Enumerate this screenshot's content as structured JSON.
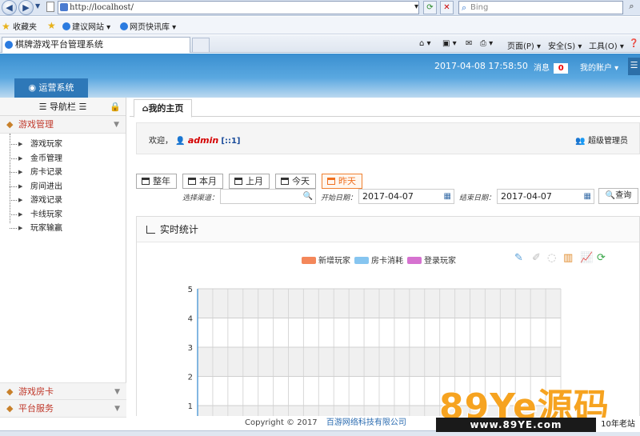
{
  "browser": {
    "address": "http://localhost/",
    "search_placeholder": "Bing",
    "favorites_label": "收藏夹",
    "fav_links": [
      "建议网站 ▾",
      "网页快讯库 ▾"
    ],
    "tab_title": "棋牌游戏平台管理系统",
    "commands": {
      "page": "页面(P) ▾",
      "safety": "安全(S) ▾",
      "tools": "工具(O) ▾"
    }
  },
  "header": {
    "datetime": "2017-04-08 17:58:50",
    "msg_label": "消息",
    "msg_count": "0",
    "account": "我的账户 ▾",
    "system_tab": "运营系统"
  },
  "sidebar": {
    "title": "导航栏",
    "group1": "游戏管理",
    "items": [
      "游戏玩家",
      "金币管理",
      "房卡记录",
      "房间进出",
      "游戏记录",
      "卡线玩家",
      "玩家输赢"
    ],
    "group2": "游戏房卡",
    "group3": "平台服务"
  },
  "main": {
    "home_tab": "我的主页",
    "welcome_prefix": "欢迎，",
    "admin": "admin",
    "ip": "[::1]",
    "role": "超级管理员",
    "ranges": [
      "整年",
      "本月",
      "上月",
      "今天",
      "昨天"
    ],
    "channel_label": "选择渠道：",
    "start_label": "开始日期：",
    "start_date": "2017-04-07",
    "end_label": "结束日期：",
    "end_date": "2017-04-07",
    "query": "查询",
    "panel_title": "实时统计"
  },
  "chart_data": {
    "type": "line",
    "title": "",
    "series": [
      {
        "name": "新增玩家",
        "color": "#f4875a",
        "values": []
      },
      {
        "name": "房卡消耗",
        "color": "#86c5f0",
        "values": []
      },
      {
        "name": "登录玩家",
        "color": "#d672d0",
        "values": []
      }
    ],
    "y_ticks": [
      "5",
      "4",
      "3",
      "2",
      "1"
    ],
    "ylim": [
      0,
      5
    ],
    "grid": true,
    "legend": "top"
  },
  "footer": {
    "copy": "Copyright © 2017",
    "company": "百游网络科技有限公司"
  },
  "watermark": {
    "brand": "89Ye源码",
    "url": "www.89YE.com",
    "tag": "10年老站"
  }
}
